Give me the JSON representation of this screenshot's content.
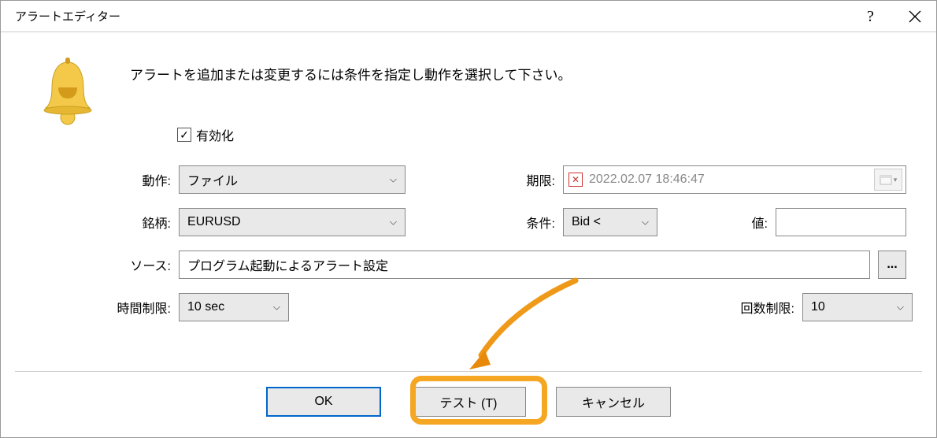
{
  "titlebar": {
    "title": "アラートエディター"
  },
  "instruction": "アラートを追加または変更するには条件を指定し動作を選択して下さい。",
  "enable": {
    "label": "有効化",
    "checked": true
  },
  "fields": {
    "action": {
      "label": "動作:",
      "value": "ファイル"
    },
    "expiration": {
      "label": "期限:",
      "value": "2022.02.07 18:46:47"
    },
    "symbol": {
      "label": "銘柄:",
      "value": "EURUSD"
    },
    "condition": {
      "label": "条件:",
      "value": "Bid <"
    },
    "value": {
      "label": "値:",
      "value": ""
    },
    "source": {
      "label": "ソース:",
      "value": "プログラム起動によるアラート設定"
    },
    "timeout": {
      "label": "時間制限:",
      "value": "10 sec"
    },
    "max_iterations": {
      "label": "回数制限:",
      "value": "10"
    }
  },
  "buttons": {
    "ok": "OK",
    "test": "テスト (T)",
    "cancel": "キャンセル"
  },
  "browse": "..."
}
